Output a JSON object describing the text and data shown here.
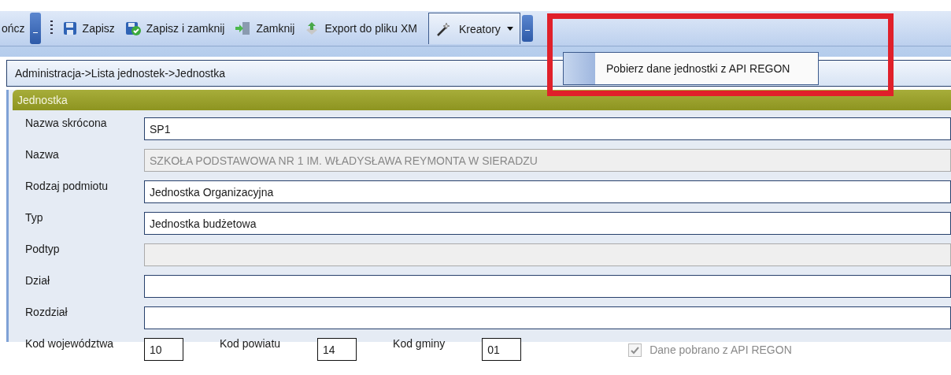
{
  "toolbar": {
    "items": [
      {
        "kind": "text",
        "label": "ończ"
      },
      {
        "kind": "overflow"
      },
      {
        "kind": "grip"
      },
      {
        "kind": "button",
        "label": "Zapisz"
      },
      {
        "kind": "button",
        "label": "Zapisz i zamknij"
      },
      {
        "kind": "button",
        "label": "Zamknij"
      },
      {
        "kind": "button",
        "label": "Export do pliku XM"
      }
    ],
    "dropdown": {
      "label": "Kreatory",
      "expanded": true,
      "menu": [
        "Pobierz dane jednostki z API REGON"
      ]
    }
  },
  "breadcrumb": "Administracja->Lista jednostek->Jednostka",
  "panel": {
    "title": "Jednostka",
    "fields": [
      {
        "label": "Nazwa skrócona",
        "value": "SP1",
        "disabled": false
      },
      {
        "label": "Nazwa",
        "value": "SZKOŁA PODSTAWOWA NR 1 IM. WŁADYSŁAWA REYMONTA W SIERADZU",
        "disabled": true
      },
      {
        "label": "Rodzaj podmiotu",
        "value": "Jednostka Organizacyjna",
        "disabled": false
      },
      {
        "label": "Typ",
        "value": "Jednostka budżetowa",
        "disabled": false
      },
      {
        "label": "Podtyp",
        "disabled": true
      },
      {
        "label": "Dział",
        "disabled": false
      },
      {
        "label": "Rozdział",
        "disabled": false
      }
    ],
    "codes": [
      {
        "label": "Kod województwa",
        "value": "10"
      },
      {
        "label": "Kod powiatu",
        "value": "14"
      },
      {
        "label": "Kod gminy",
        "value": "01"
      }
    ],
    "checkbox": {
      "label": "Dane pobrano z API REGON",
      "checked": true,
      "disabled": true
    }
  }
}
